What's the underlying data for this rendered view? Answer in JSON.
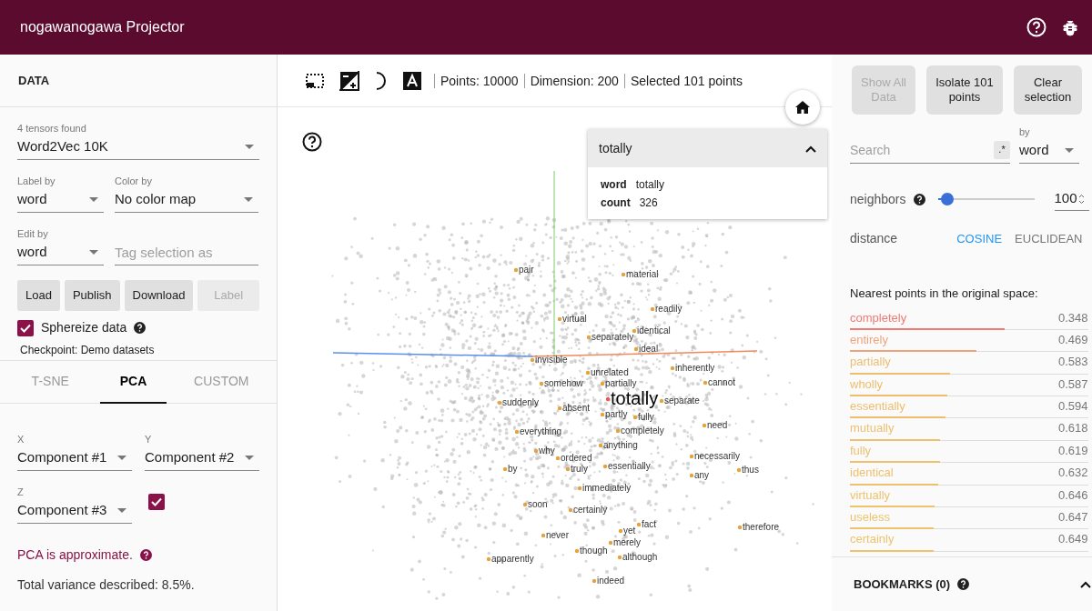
{
  "header": {
    "title": "nogawanogawa Projector"
  },
  "data_panel": {
    "title": "DATA",
    "tensor": {
      "label": "4 tensors found",
      "value": "Word2Vec 10K"
    },
    "label_by": {
      "label": "Label by",
      "value": "word"
    },
    "color_by": {
      "label": "Color by",
      "value": "No color map"
    },
    "edit_by": {
      "label": "Edit by",
      "value": "word"
    },
    "tag": {
      "placeholder": "Tag selection as"
    },
    "buttons": [
      {
        "label": "Load",
        "disabled": false
      },
      {
        "label": "Publish",
        "disabled": false
      },
      {
        "label": "Download",
        "disabled": false
      },
      {
        "label": "Label",
        "disabled": true
      }
    ],
    "sphereize": {
      "label": "Sphereize data",
      "checked": true
    },
    "checkpoint": "Checkpoint: Demo datasets"
  },
  "projection_tabs": [
    {
      "label": "T-SNE",
      "selected": false
    },
    {
      "label": "PCA",
      "selected": true
    },
    {
      "label": "CUSTOM",
      "selected": false
    }
  ],
  "pca": {
    "x": {
      "label": "X",
      "value": "Component #1"
    },
    "y": {
      "label": "Y",
      "value": "Component #2"
    },
    "z": {
      "label": "Z",
      "value": "Component #3"
    },
    "z_checked": true,
    "note": "PCA is approximate.",
    "variance": "Total variance described: 8.5%."
  },
  "toolbar": {
    "stats": [
      "Points: 10000",
      "Dimension: 200",
      "Selected 101 points"
    ]
  },
  "canvas": {
    "labels": [
      {
        "text": "pair",
        "selected": false
      },
      {
        "text": "material",
        "selected": false
      },
      {
        "text": "readily",
        "selected": false
      },
      {
        "text": "virtual",
        "selected": false
      },
      {
        "text": "identical",
        "selected": false
      },
      {
        "text": "separately",
        "selected": false
      },
      {
        "text": "ideal",
        "selected": false
      },
      {
        "text": "invisible",
        "selected": false
      },
      {
        "text": "inherently",
        "selected": false
      },
      {
        "text": "unrelated",
        "selected": false
      },
      {
        "text": "somehow",
        "selected": false
      },
      {
        "text": "partially",
        "selected": false
      },
      {
        "text": "cannot",
        "selected": false
      },
      {
        "text": "suddenly",
        "selected": false
      },
      {
        "text": "totally",
        "selected": true
      },
      {
        "text": "separate",
        "selected": false
      },
      {
        "text": "absent",
        "selected": false
      },
      {
        "text": "partly",
        "selected": false
      },
      {
        "text": "fully",
        "selected": false
      },
      {
        "text": "need",
        "selected": false
      },
      {
        "text": "everything",
        "selected": false
      },
      {
        "text": "completely",
        "selected": false
      },
      {
        "text": "anything",
        "selected": false
      },
      {
        "text": "why",
        "selected": false
      },
      {
        "text": "ordered",
        "selected": false
      },
      {
        "text": "necessarily",
        "selected": false
      },
      {
        "text": "by",
        "selected": false
      },
      {
        "text": "truly",
        "selected": false
      },
      {
        "text": "essentially",
        "selected": false
      },
      {
        "text": "thus",
        "selected": false
      },
      {
        "text": "any",
        "selected": false
      },
      {
        "text": "immediately",
        "selected": false
      },
      {
        "text": "soon",
        "selected": false
      },
      {
        "text": "certainly",
        "selected": false
      },
      {
        "text": "fact",
        "selected": false
      },
      {
        "text": "therefore",
        "selected": false
      },
      {
        "text": "yet",
        "selected": false
      },
      {
        "text": "never",
        "selected": false
      },
      {
        "text": "merely",
        "selected": false
      },
      {
        "text": "though",
        "selected": false
      },
      {
        "text": "although",
        "selected": false
      },
      {
        "text": "apparently",
        "selected": false
      },
      {
        "text": "indeed",
        "selected": false
      }
    ]
  },
  "tooltip": {
    "title": "totally",
    "expanded": true,
    "fields": [
      {
        "key": "word",
        "value": "totally"
      },
      {
        "key": "count",
        "value": "326"
      }
    ]
  },
  "inspector": {
    "buttons": [
      {
        "label": "Show All Data",
        "disabled": true
      },
      {
        "label": "Isolate 101 points",
        "disabled": false
      },
      {
        "label": "Clear selection",
        "disabled": false
      }
    ],
    "search": {
      "placeholder": "Search"
    },
    "regex": ".*",
    "search_by": {
      "label": "by",
      "value": "word"
    },
    "neighbors": {
      "label": "neighbors",
      "level": 0.1,
      "value": "100"
    },
    "distance": {
      "label": "distance",
      "options": [
        {
          "label": "COSINE",
          "selected": true
        },
        {
          "label": "EUCLIDEAN",
          "selected": false
        }
      ]
    },
    "nearest_title": "Nearest points in the original space:",
    "nearest": [
      {
        "word": "completely",
        "value": "0.348",
        "level": 0.65,
        "color": "#f07a72"
      },
      {
        "word": "entirely",
        "value": "0.469",
        "level": 0.53,
        "color": "#f0a37a"
      },
      {
        "word": "partially",
        "value": "0.583",
        "level": 0.42,
        "color": "#eebd6e"
      },
      {
        "word": "wholly",
        "value": "0.587",
        "level": 0.41,
        "color": "#eebd6e"
      },
      {
        "word": "essentially",
        "value": "0.594",
        "level": 0.4,
        "color": "#eebd6e"
      },
      {
        "word": "mutually",
        "value": "0.618",
        "level": 0.38,
        "color": "#eec06e"
      },
      {
        "word": "fully",
        "value": "0.619",
        "level": 0.38,
        "color": "#eec06e"
      },
      {
        "word": "identical",
        "value": "0.632",
        "level": 0.37,
        "color": "#eec06e"
      },
      {
        "word": "virtually",
        "value": "0.646",
        "level": 0.355,
        "color": "#eec36e"
      },
      {
        "word": "useless",
        "value": "0.647",
        "level": 0.35,
        "color": "#eec36e"
      },
      {
        "word": "certainly",
        "value": "0.649",
        "level": 0.35,
        "color": "#eec36e"
      }
    ]
  },
  "bookmarks": {
    "title": "BOOKMARKS (0)"
  }
}
